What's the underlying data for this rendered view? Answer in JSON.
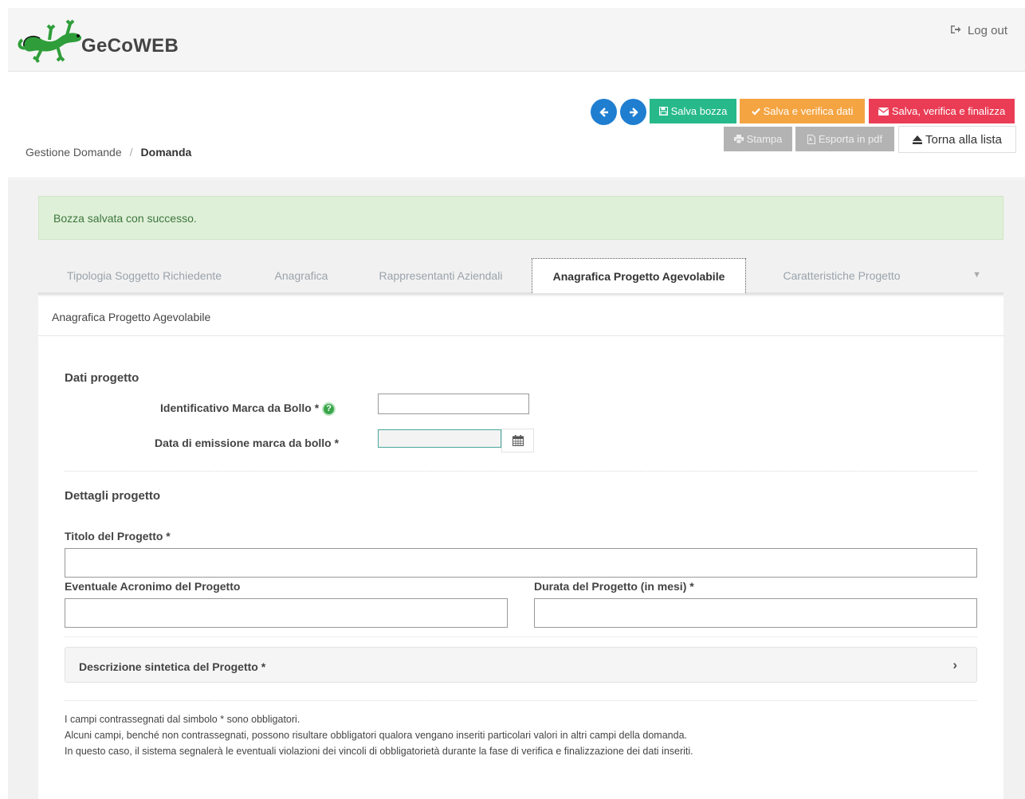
{
  "app": {
    "brand": "GeCoWEB",
    "logout_label": "Log out"
  },
  "nav": {
    "prev_icon": "arrow-left-icon",
    "next_icon": "arrow-right-icon"
  },
  "toolbar": {
    "save_draft": "Salva bozza",
    "save_verify": "Salva e verifica dati",
    "save_verify_finalize": "Salva, verifica e finalizza",
    "print": "Stampa",
    "export_pdf": "Esporta in pdf",
    "back_to_list": "Torna alla lista"
  },
  "breadcrumb": {
    "parent": "Gestione Domande",
    "separator": "/",
    "current": "Domanda"
  },
  "alert": {
    "message": "Bozza salvata con successo."
  },
  "tabs": [
    {
      "label": "Tipologia Soggetto Richiedente"
    },
    {
      "label": "Anagrafica"
    },
    {
      "label": "Rappresentanti Aziendali"
    },
    {
      "label": "Anagrafica Progetto Agevolabile"
    },
    {
      "label": "Caratteristiche Progetto"
    }
  ],
  "panel": {
    "title": "Anagrafica Progetto Agevolabile",
    "section_dati": "Dati progetto",
    "label_marca_id": "Identificativo Marca da Bollo *",
    "help_glyph": "?",
    "label_marca_date": "Data di emissione marca da bollo *",
    "value_marca_id": "",
    "value_marca_date": "",
    "section_dettagli": "Dettagli progetto",
    "label_titolo": "Titolo del Progetto *",
    "value_titolo": "",
    "label_acronimo": "Eventuale Acronimo del Progetto",
    "value_acronimo": "",
    "label_durata": "Durata del Progetto (in mesi) *",
    "value_durata": "",
    "accordion_label": "Descrizione sintetica del Progetto *"
  },
  "notes": [
    "I campi contrassegnati dal simbolo * sono obbligatori.",
    "Alcuni campi, benché non contrassegnati, possono risultare obbligatori qualora vengano inseriti particolari valori in altri campi della domanda.",
    "In questo caso, il sistema segnalerà le eventuali violazioni dei vincoli di obbligatorietà durante la fase di verifica e finalizzazione dei dati inseriti."
  ],
  "colors": {
    "primary_blue": "#1f7ed0",
    "green": "#27b989",
    "orange": "#f5a442",
    "red": "#ea3d55",
    "success_bg": "#dff0d8"
  }
}
